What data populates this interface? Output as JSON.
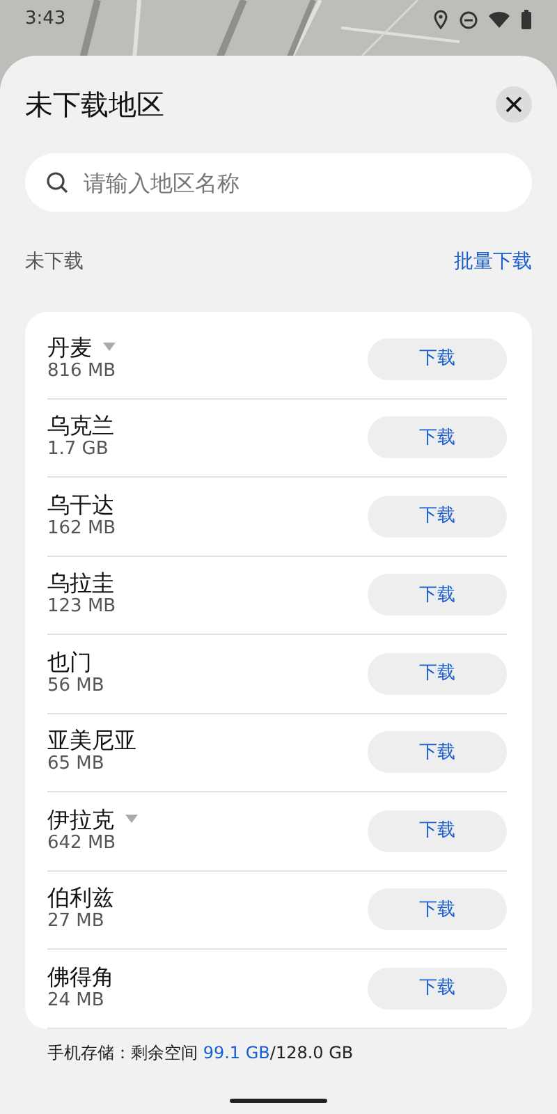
{
  "status_bar": {
    "time": "3:43"
  },
  "sheet": {
    "title": "未下载地区",
    "search": {
      "placeholder": "请输入地区名称"
    },
    "section": {
      "label": "未下载",
      "action": "批量下载"
    },
    "regions": [
      {
        "name": "丹麦",
        "size": "816 MB",
        "expandable": true,
        "button": "下载"
      },
      {
        "name": "乌克兰",
        "size": "1.7 GB",
        "expandable": false,
        "button": "下载"
      },
      {
        "name": "乌干达",
        "size": "162 MB",
        "expandable": false,
        "button": "下载"
      },
      {
        "name": "乌拉圭",
        "size": "123 MB",
        "expandable": false,
        "button": "下载"
      },
      {
        "name": "也门",
        "size": "56 MB",
        "expandable": false,
        "button": "下载"
      },
      {
        "name": "亚美尼亚",
        "size": "65 MB",
        "expandable": false,
        "button": "下载"
      },
      {
        "name": "伊拉克",
        "size": "642 MB",
        "expandable": true,
        "button": "下载"
      },
      {
        "name": "伯利兹",
        "size": "27 MB",
        "expandable": false,
        "button": "下载"
      },
      {
        "name": "佛得角",
        "size": "24 MB",
        "expandable": false,
        "button": "下载"
      }
    ],
    "storage": {
      "label": "手机存储：剩余空间 ",
      "free": "99.1 GB",
      "total": "/128.0 GB"
    }
  }
}
